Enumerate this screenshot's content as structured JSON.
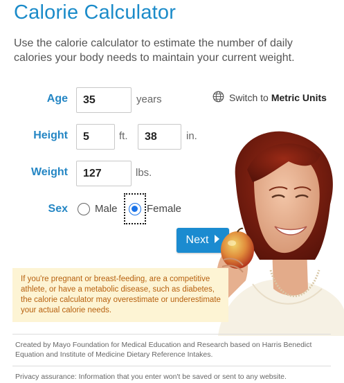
{
  "page": {
    "title": "Calorie Calculator",
    "intro": "Use the calorie calculator to estimate the number of daily calories your body needs to maintain your current weight."
  },
  "form": {
    "age": {
      "label": "Age",
      "value": "35",
      "unit": "years"
    },
    "height": {
      "label": "Height",
      "feet": "5",
      "feet_unit": "ft.",
      "inches": "38",
      "inches_unit": "in."
    },
    "weight": {
      "label": "Weight",
      "value": "127",
      "unit": "lbs."
    },
    "sex": {
      "label": "Sex",
      "options": [
        "Male",
        "Female"
      ],
      "selected": "Female"
    },
    "next_label": "Next"
  },
  "metric_toggle": {
    "prefix": "Switch to",
    "bold": "Metric Units",
    "icon": "globe-icon"
  },
  "note": "If you're pregnant or breast-feeding, are a competitive athlete, or have a metabolic disease, such as diabetes, the calorie calculator may overestimate or underestimate your actual calorie needs.",
  "footer": {
    "credit": "Created by Mayo Foundation for Medical Education and Research based on Harris Benedict Equation and Institute of Medicine Dietary Reference Intakes.",
    "privacy": "Privacy assurance: Information that you enter won't be saved or sent to any website."
  },
  "colors": {
    "accent": "#1b8bc9",
    "button": "#1b8bd0",
    "note_bg": "#fdf4d4",
    "note_text": "#b7610f",
    "radio_selected": "#1a73e8"
  }
}
